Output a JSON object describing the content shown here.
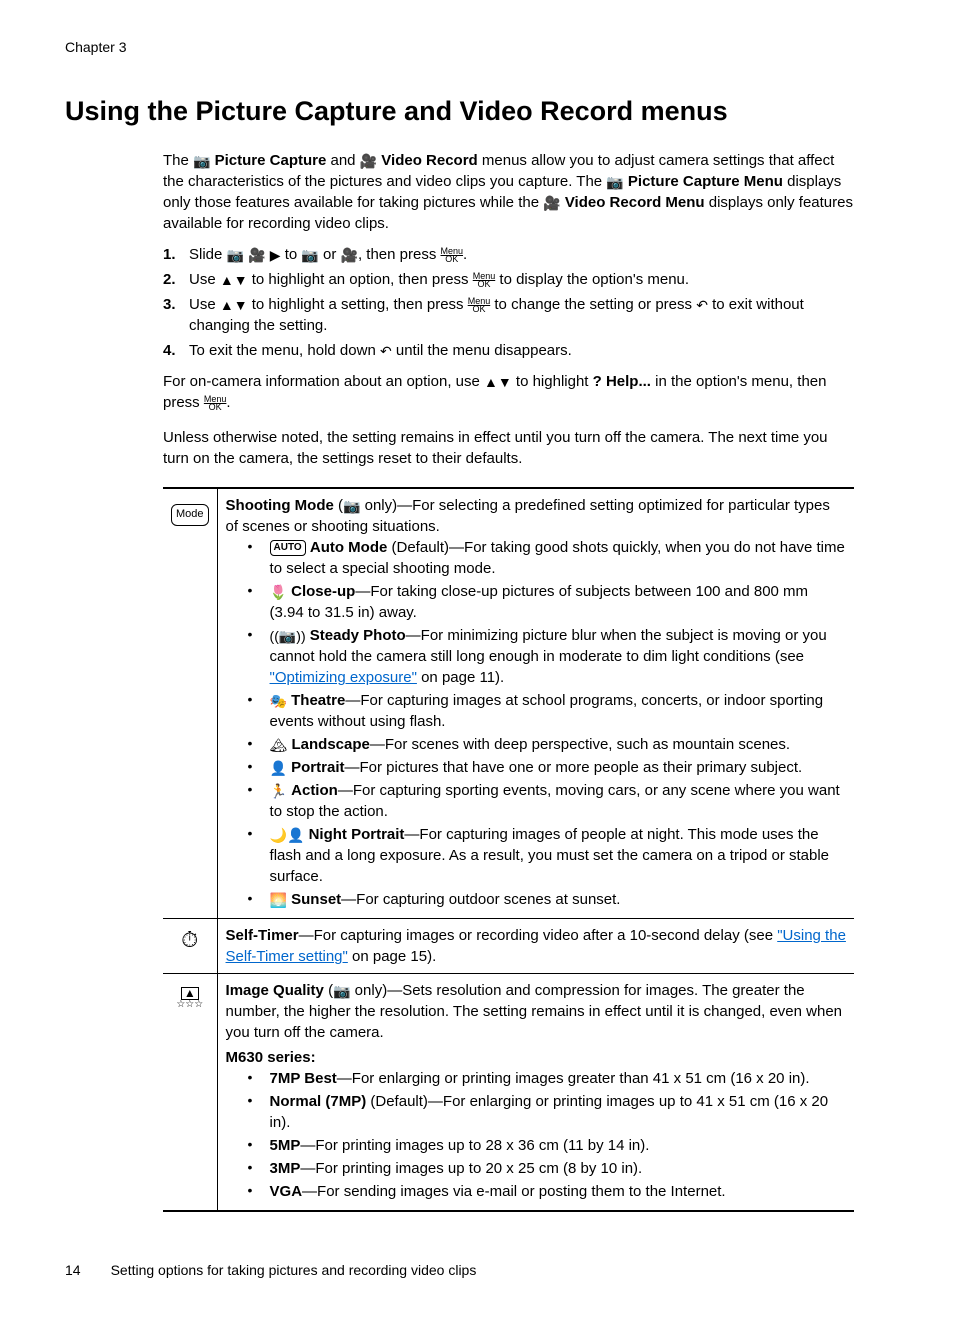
{
  "chapter": "Chapter 3",
  "title": "Using the Picture Capture and Video Record menus",
  "intro": {
    "p1_a": "The ",
    "p1_b": " Picture Capture",
    "p1_c": " and ",
    "p1_d": " Video Record",
    "p1_e": " menus allow you to adjust camera settings that affect the characteristics of the pictures and video clips you capture. The ",
    "p1_f": " Picture Capture Menu",
    "p1_g": " displays only those features available for taking pictures while the ",
    "p1_h": " Video Record Menu",
    "p1_i": " displays only features available for recording video clips."
  },
  "steps": {
    "s1_a": "Slide ",
    "s1_b": " to ",
    "s1_c": " or ",
    "s1_d": ", then press ",
    "s1_e": ".",
    "s2_a": "Use ",
    "s2_b": " to highlight an option, then press ",
    "s2_c": " to display the option's menu.",
    "s3_a": "Use ",
    "s3_b": " to highlight a setting, then press ",
    "s3_c": " to change the setting or press ",
    "s3_d": " to exit without changing the setting.",
    "s4_a": "To exit the menu, hold down ",
    "s4_b": " until the menu disappears."
  },
  "help": {
    "a": "For on-camera information about an option, use ",
    "b": " to highlight ",
    "c": " Help...",
    "d": " in the option's menu, then press ",
    "e": "."
  },
  "note": "Unless otherwise noted, the setting remains in effect until you turn off the camera. The next time you turn on the camera, the settings reset to their defaults.",
  "table": {
    "modeLabel": "Mode",
    "shooting": {
      "head_a": "Shooting Mode",
      "head_b": " (",
      "head_c": " only)—For selecting a predefined setting optimized for particular types of scenes or shooting situations.",
      "auto_a": "Auto Mode",
      "auto_b": " (Default)—For taking good shots quickly, when you do not have time to select a special shooting mode.",
      "auto_badge": "AUTO",
      "closeup_a": "Close-up",
      "closeup_b": "—For taking close-up pictures of subjects between 100 and 800 mm (3.94 to 31.5 in) away.",
      "steady_a": "Steady Photo",
      "steady_b": "—For minimizing picture blur when the subject is moving or you cannot hold the camera still long enough in moderate to dim light conditions (see ",
      "steady_link": "\"Optimizing exposure\"",
      "steady_c": " on page 11).",
      "theatre_a": "Theatre",
      "theatre_b": "—For capturing images at school programs, concerts, or indoor sporting events without using flash.",
      "landscape_a": "Landscape",
      "landscape_b": "—For scenes with deep perspective, such as mountain scenes.",
      "portrait_a": "Portrait",
      "portrait_b": "—For pictures that have one or more people as their primary subject.",
      "action_a": "Action",
      "action_b": "—For capturing sporting events, moving cars, or any scene where you want to stop the action.",
      "night_a": "Night Portrait",
      "night_b": "—For capturing images of people at night. This mode uses the flash and a long exposure. As a result, you must set the camera on a tripod or stable surface.",
      "sunset_a": "Sunset",
      "sunset_b": "—For capturing outdoor scenes at sunset."
    },
    "timer": {
      "head_a": "Self-Timer",
      "head_b": "—For capturing images or recording video after a 10-second delay (see ",
      "link": "\"Using the Self-Timer setting\"",
      "head_c": " on page 15)."
    },
    "quality": {
      "head_a": "Image Quality",
      "head_b": " (",
      "head_c": " only)—Sets resolution and compression for images. The greater the number, the higher the resolution. The setting remains in effect until it is changed, even when you turn off the camera.",
      "series": "M630 series:",
      "q7best_a": "7MP Best",
      "q7best_b": "—For enlarging or printing images greater than 41 x 51 cm (16 x 20 in).",
      "q7norm_a": "Normal (7MP)",
      "q7norm_b": " (Default)—For enlarging or printing images up to 41 x 51 cm (16 x 20 in).",
      "q5_a": "5MP",
      "q5_b": "—For printing images up to 28 x 36 cm (11 by 14 in).",
      "q3_a": "3MP",
      "q3_b": "—For printing images up to 20 x 25 cm (8 by 10 in).",
      "qvga_a": "VGA",
      "qvga_b": "—For sending images via e-mail or posting them to the Internet."
    }
  },
  "footer": {
    "page": "14",
    "section": "Setting options for taking pictures and recording video clips"
  },
  "icons": {
    "camera": "📷",
    "video": "🎥",
    "play": "▶",
    "updown": "▲▼",
    "back": "↶",
    "help": "?",
    "timer": "⏱",
    "flower": "🌷",
    "steady": "((📷))",
    "theatre": "🎭",
    "landscape": "🏔",
    "portrait": "👤",
    "action": "🏃",
    "night": "🌙👤",
    "sunset": "🌅"
  }
}
